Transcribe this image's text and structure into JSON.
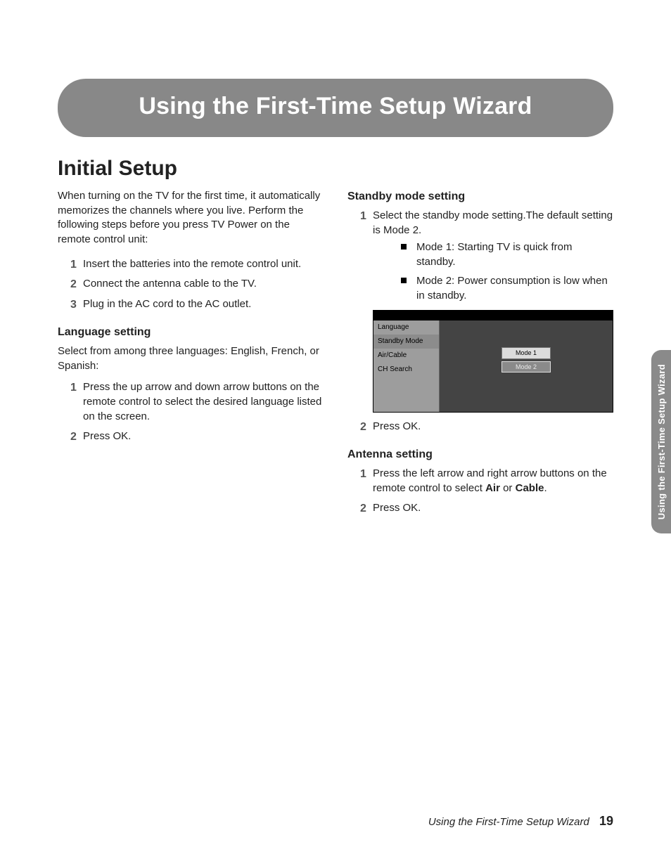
{
  "chapter_title": "Using the First-Time Setup Wizard",
  "section_title": "Initial Setup",
  "left": {
    "intro": "When turning on the TV for the first time, it automatically memorizes the channels where you live. Perform the following steps before you press TV Power on the remote control unit:",
    "steps": {
      "s1_n": "1",
      "s1": "Insert the batteries into the remote control unit.",
      "s2_n": "2",
      "s2": "Connect the antenna cable to the TV.",
      "s3_n": "3",
      "s3": "Plug in the AC cord to the AC outlet."
    },
    "lang_h": "Language setting",
    "lang_p": "Select from among three languages: English, French, or Spanish:",
    "lang_steps": {
      "s1_n": "1",
      "s1": "Press the up arrow and down arrow buttons on the remote control to select the desired language listed on the screen.",
      "s2_n": "2",
      "s2": "Press OK."
    }
  },
  "right": {
    "standby_h": "Standby mode setting",
    "standby_steps": {
      "s1_n": "1",
      "s1": "Select the standby mode setting.The default setting is Mode 2.",
      "b1": "Mode 1: Starting TV is quick from standby.",
      "b2": "Mode 2: Power consumption is low when in standby.",
      "s2_n": "2",
      "s2": "Press OK."
    },
    "menu": {
      "side": {
        "i1": "Language",
        "i2": "Standby Mode",
        "i3": "Air/Cable",
        "i4": "CH Search"
      },
      "opts": {
        "o1": "Mode 1",
        "o2": "Mode 2"
      }
    },
    "antenna_h": "Antenna setting",
    "antenna_steps": {
      "s1_n": "1",
      "s1_pre": "Press the left arrow and right arrow buttons on the remote control to select ",
      "s1_b1": "Air",
      "s1_mid": " or ",
      "s1_b2": "Cable",
      "s1_post": ".",
      "s2_n": "2",
      "s2": "Press OK."
    }
  },
  "side_tab": "Using the First-Time Setup Wizard",
  "footer": {
    "title": "Using the First-Time Setup Wizard",
    "page": "19"
  }
}
